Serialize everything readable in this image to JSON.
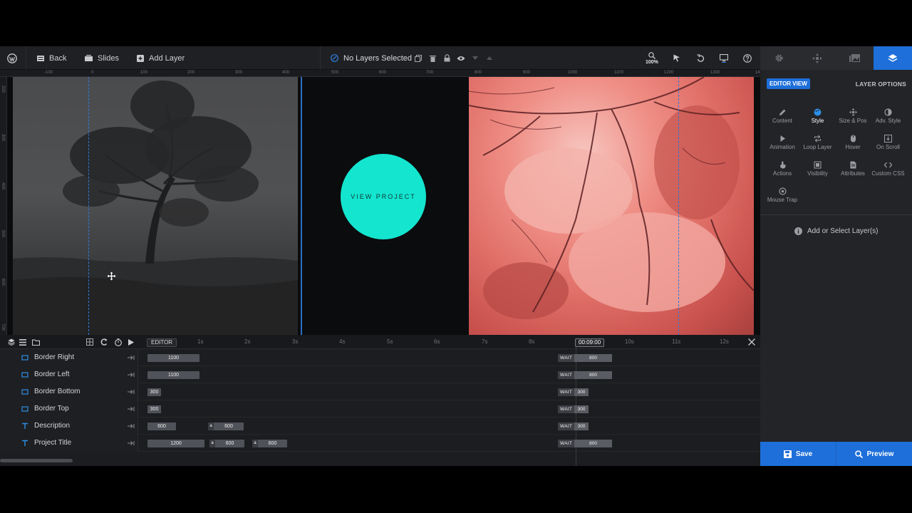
{
  "toolbar": {
    "back_label": "Back",
    "slides_label": "Slides",
    "add_layer_label": "Add Layer",
    "selection_status": "No Layers Selected",
    "zoom_level": "100%"
  },
  "ruler": {
    "h_ticks": [
      "-100",
      "0",
      "100",
      "200",
      "300",
      "400",
      "500",
      "600",
      "700",
      "800",
      "900",
      "1000",
      "1100",
      "1200",
      "1300",
      "14"
    ],
    "v_ticks": [
      "200",
      "300",
      "400",
      "500",
      "600",
      "700"
    ]
  },
  "canvas": {
    "cta_label": "VIEW PROJECT",
    "cta_color": "#14e5cf",
    "accent_guide_color": "#2d77d6"
  },
  "timeline": {
    "editor_label": "EDITOR",
    "current_time": "00:09:00",
    "ticks": [
      "1s",
      "2s",
      "3s",
      "4s",
      "5s",
      "6s",
      "7s",
      "8s",
      "10s",
      "11s",
      "12s"
    ],
    "rows": [
      {
        "name": "Border Right",
        "icon": "square-icon",
        "bars": [
          "1100"
        ],
        "wait": "800"
      },
      {
        "name": "Border Left",
        "icon": "square-icon",
        "bars": [
          "1100"
        ],
        "wait": "800"
      },
      {
        "name": "Border Bottom",
        "icon": "square-icon",
        "bars": [
          "300"
        ],
        "wait": "300"
      },
      {
        "name": "Border Top",
        "icon": "square-icon",
        "bars": [
          "300"
        ],
        "wait": "300"
      },
      {
        "name": "Description",
        "icon": "text-icon",
        "bars": [
          "600",
          "600"
        ],
        "wait": "300"
      },
      {
        "name": "Project Title",
        "icon": "text-icon",
        "bars": [
          "1200",
          "600",
          "600"
        ],
        "wait": "800"
      }
    ],
    "bar_letter": "a",
    "wait_label": "WAIT"
  },
  "panel": {
    "editor_view_label": "EDITOR VIEW",
    "layer_options_label": "LAYER OPTIONS",
    "options": [
      {
        "label": "Content",
        "icon": "pencil-icon"
      },
      {
        "label": "Style",
        "icon": "palette-icon"
      },
      {
        "label": "Size & Pos",
        "icon": "move-icon"
      },
      {
        "label": "Adv. Style",
        "icon": "contrast-icon"
      },
      {
        "label": "Animation",
        "icon": "play-icon"
      },
      {
        "label": "Loop Layer",
        "icon": "loop-icon"
      },
      {
        "label": "Hover",
        "icon": "mouse-icon"
      },
      {
        "label": "On Scroll",
        "icon": "scroll-icon"
      },
      {
        "label": "Actions",
        "icon": "hand-icon"
      },
      {
        "label": "Visibility",
        "icon": "visibility-icon"
      },
      {
        "label": "Attributes",
        "icon": "file-icon"
      },
      {
        "label": "Custom CSS",
        "icon": "code-icon"
      },
      {
        "label": "Mouse Trap",
        "icon": "target-icon"
      }
    ],
    "active_option": "Style",
    "info_message": "Add or Select Layer(s)",
    "save_label": "Save",
    "preview_label": "Preview",
    "accent_color": "#1e6fd9"
  }
}
